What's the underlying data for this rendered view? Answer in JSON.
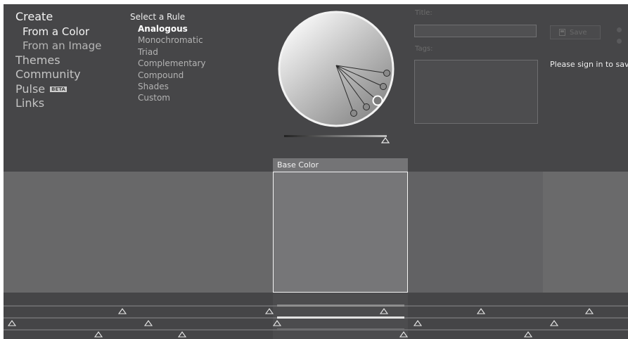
{
  "nav": {
    "create": "Create",
    "from_color": "From a Color",
    "from_image": "From an Image",
    "themes": "Themes",
    "community": "Community",
    "pulse": "Pulse",
    "beta_badge": "BETA",
    "links": "Links"
  },
  "rules": {
    "title": "Select a Rule",
    "items": [
      "Analogous",
      "Monochromatic",
      "Triad",
      "Complementary",
      "Compound",
      "Shades",
      "Custom"
    ],
    "selected": "Analogous"
  },
  "form": {
    "title_label": "Title:",
    "title_value": "",
    "tags_label": "Tags:",
    "tags_value": "",
    "save_label": "Save",
    "signin_message": "Please sign in to save y"
  },
  "base_color": {
    "label": "Base Color"
  },
  "colors": {
    "app_bg": "#444446",
    "swatches": [
      "#686869",
      "#686869",
      "#767678",
      "#626264",
      "#6a6a6b"
    ],
    "base_swatch_border": "#f4f4f4"
  },
  "icons": [
    "save-icon",
    "color-wheel",
    "slider-thumb-icon",
    "beta-badge"
  ]
}
